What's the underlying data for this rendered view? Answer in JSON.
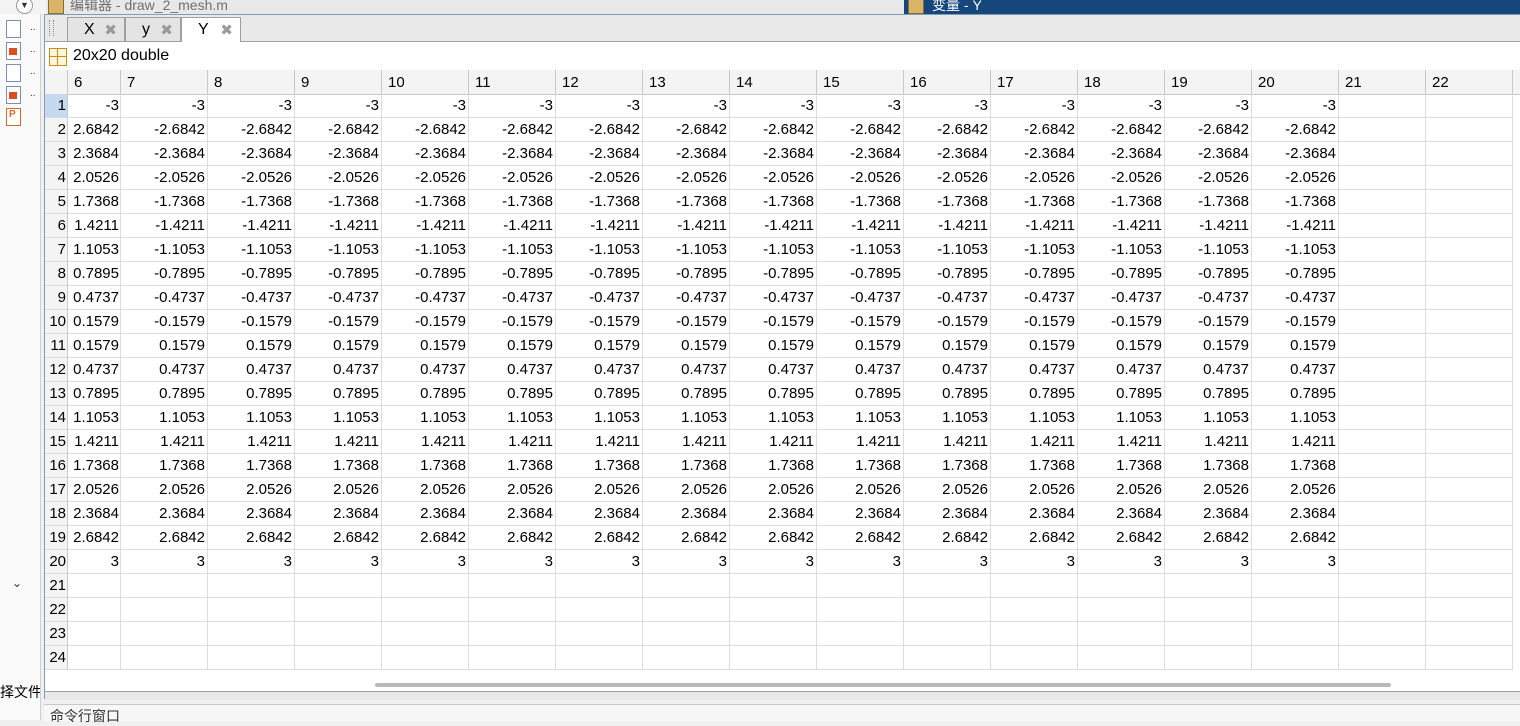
{
  "editor_title": "编辑器 - draw_2_mesh.m",
  "variables_title": "变量 - Y",
  "tabs": [
    {
      "label": "X",
      "active": false
    },
    {
      "label": "y",
      "active": false
    },
    {
      "label": "Y",
      "active": true
    }
  ],
  "tab_close_glyph": "✖",
  "variable_size": "20x20 double",
  "column_headers": [
    "6",
    "7",
    "8",
    "9",
    "10",
    "11",
    "12",
    "13",
    "14",
    "15",
    "16",
    "17",
    "18",
    "19",
    "20",
    "21",
    "22"
  ],
  "first_column_display": [
    "-3",
    "2.6842",
    "2.3684",
    "2.0526",
    "1.7368",
    "1.4211",
    "1.1053",
    "0.7895",
    "0.4737",
    "0.1579",
    "0.1579",
    "0.4737",
    "0.7895",
    "1.1053",
    "1.4211",
    "1.7368",
    "2.0526",
    "2.3684",
    "2.6842",
    "3"
  ],
  "rows": [
    {
      "index": "1",
      "value": "-3"
    },
    {
      "index": "2",
      "value": "-2.6842"
    },
    {
      "index": "3",
      "value": "-2.3684"
    },
    {
      "index": "4",
      "value": "-2.0526"
    },
    {
      "index": "5",
      "value": "-1.7368"
    },
    {
      "index": "6",
      "value": "-1.4211"
    },
    {
      "index": "7",
      "value": "-1.1053"
    },
    {
      "index": "8",
      "value": "-0.7895"
    },
    {
      "index": "9",
      "value": "-0.4737"
    },
    {
      "index": "10",
      "value": "-0.1579"
    },
    {
      "index": "11",
      "value": "0.1579"
    },
    {
      "index": "12",
      "value": "0.4737"
    },
    {
      "index": "13",
      "value": "0.7895"
    },
    {
      "index": "14",
      "value": "1.1053"
    },
    {
      "index": "15",
      "value": "1.4211"
    },
    {
      "index": "16",
      "value": "1.7368"
    },
    {
      "index": "17",
      "value": "2.0526"
    },
    {
      "index": "18",
      "value": "2.3684"
    },
    {
      "index": "19",
      "value": "2.6842"
    },
    {
      "index": "20",
      "value": "3"
    }
  ],
  "empty_row_indices": [
    "21",
    "22",
    "23",
    "24"
  ],
  "selected_row": "1",
  "left_panel_text": "择文件",
  "left_dots": [
    "..",
    "..",
    "..",
    ".."
  ],
  "command_window_title": "命令行窗口",
  "colors": {
    "title_active": "#15467c",
    "grid_line": "#dcdcdc",
    "selected_row_header": "#c5d9f1"
  }
}
